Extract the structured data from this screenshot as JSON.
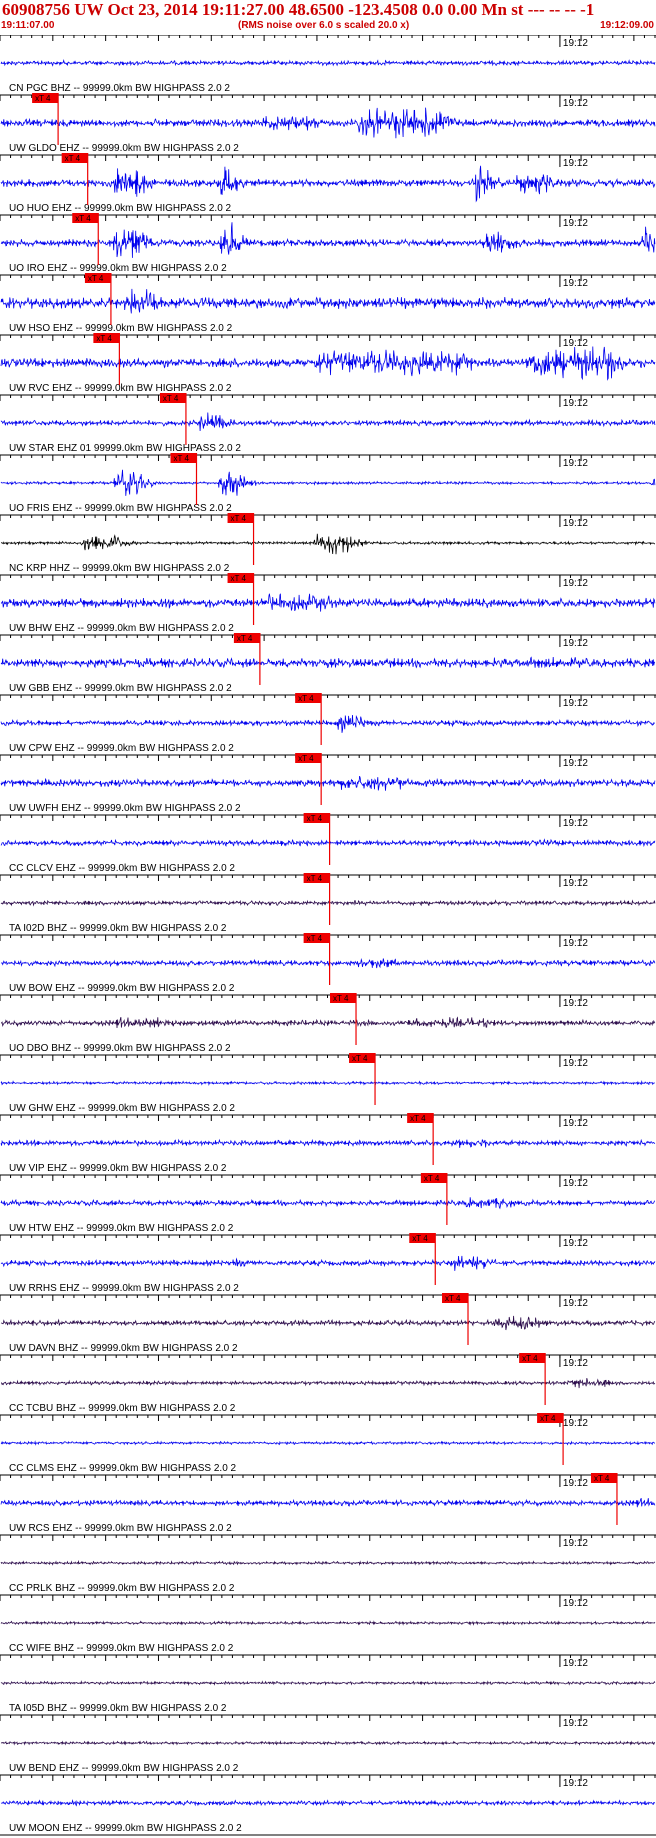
{
  "header": {
    "title": "60908756 UW Oct 23, 2014 19:11:27.00   48.6500 -123.4508  0.0 0.00 Mn st --- -- --  -1",
    "start_time": "19:11:07.00",
    "note": "(RMS noise over 6.0 s scaled 20.0 x)",
    "end_time": "19:12:09.00"
  },
  "chart_data": {
    "type": "line",
    "title": "60908756 UW Oct 23, 2014 19:11:27.00   48.6500 -123.4508  0.0 0.00 Mn st --- -- --  -1",
    "x_axis": {
      "start": "19:11:07.00",
      "end": "19:12:09.00",
      "minute_tick": "19:12",
      "minute_tick_seconds_from_start": 53
    },
    "pick_label": "xT 4",
    "colors": {
      "blue": "#0000ee",
      "dark": "#2a0a4a",
      "black": "#000000",
      "pick": "#ee0000"
    },
    "series": [
      {
        "name": "CN PGC BHZ -- 99999.0km BW  HIGHPASS  2.0  2",
        "color": "blue",
        "amp": 2.5,
        "pick": null,
        "events": []
      },
      {
        "name": "UW GLDO EHZ -- 99999.0km BW  HIGHPASS  2.0  2",
        "color": "blue",
        "amp": 4,
        "pick": 5.5,
        "events": [
          [
            34,
            8,
            16
          ],
          [
            25,
            5,
            8
          ]
        ]
      },
      {
        "name": "UO HUO EHZ -- 99999.0km BW  HIGHPASS  2.0  2",
        "color": "blue",
        "amp": 4,
        "pick": 8.3,
        "events": [
          [
            11,
            2,
            22
          ],
          [
            21,
            0.8,
            24
          ],
          [
            45,
            0.8,
            22
          ],
          [
            49,
            3,
            12
          ]
        ]
      },
      {
        "name": "UO IRO EHZ -- 99999.0km BW  HIGHPASS  2.0  2",
        "color": "blue",
        "amp": 4,
        "pick": 9.3,
        "events": [
          [
            11,
            2,
            22
          ],
          [
            21,
            0.8,
            24
          ],
          [
            46,
            2,
            14
          ],
          [
            61,
            0.6,
            18
          ]
        ]
      },
      {
        "name": "UW HSO EHZ -- 99999.0km BW  HIGHPASS  2.0  2",
        "color": "blue",
        "amp": 6,
        "pick": 10.5,
        "events": [
          [
            12,
            2,
            16
          ],
          [
            64,
            2,
            8
          ]
        ]
      },
      {
        "name": "UW RVC EHZ -- 99999.0km BW  HIGHPASS  2.0  2",
        "color": "blue",
        "amp": 5,
        "pick": 11.3,
        "events": [
          [
            30,
            14,
            14
          ],
          [
            50,
            8,
            18
          ]
        ]
      },
      {
        "name": "UW STAR EHZ 01 99999.0km BW  HIGHPASS  2.0  2",
        "color": "blue",
        "amp": 3,
        "pick": 17.6,
        "events": [
          [
            19,
            2,
            12
          ]
        ]
      },
      {
        "name": "UO FRIS EHZ -- 99999.0km BW  HIGHPASS  2.0  2",
        "color": "blue",
        "amp": 1.5,
        "pick": 18.6,
        "events": [
          [
            11,
            2,
            14
          ],
          [
            21,
            1,
            20
          ],
          [
            62,
            0.8,
            14
          ]
        ]
      },
      {
        "name": "NC KRP HHZ -- 99999.0km BW  HIGHPASS  2.0  2",
        "color": "black",
        "amp": 1.5,
        "pick": 24,
        "events": [
          [
            8,
            3,
            10
          ],
          [
            30,
            3,
            12
          ]
        ]
      },
      {
        "name": "UW BHW EHZ -- 99999.0km BW  HIGHPASS  2.0  2",
        "color": "blue",
        "amp": 5,
        "pick": 24,
        "events": [
          [
            25,
            6,
            10
          ]
        ]
      },
      {
        "name": "UW GBB EHZ -- 99999.0km BW  HIGHPASS  2.0  2",
        "color": "blue",
        "amp": 5,
        "pick": 24.6,
        "events": [
          [
            45,
            10,
            6
          ]
        ]
      },
      {
        "name": "UW CPW EHZ -- 99999.0km BW  HIGHPASS  2.0  2",
        "color": "blue",
        "amp": 3,
        "pick": 30.4,
        "events": [
          [
            32,
            2,
            10
          ]
        ]
      },
      {
        "name": "UW UWFH EHZ -- 99999.0km BW  HIGHPASS  2.0  2",
        "color": "blue",
        "amp": 4,
        "pick": 30.4,
        "events": [
          [
            32,
            6,
            8
          ]
        ]
      },
      {
        "name": "CC CLCV EHZ -- 99999.0km BW  HIGHPASS  2.0  2",
        "color": "blue",
        "amp": 3,
        "pick": 31.2,
        "events": [
          [
            51,
            1,
            4
          ]
        ]
      },
      {
        "name": "TA I02D BHZ -- 99999.0km BW  HIGHPASS  2.0  2",
        "color": "dark",
        "amp": 2.5,
        "pick": 31.2,
        "events": []
      },
      {
        "name": "UW BOW EHZ -- 99999.0km BW  HIGHPASS  2.0  2",
        "color": "blue",
        "amp": 3,
        "pick": 31.2,
        "events": [
          [
            34,
            3,
            6
          ]
        ]
      },
      {
        "name": "UO DBO BHZ -- 99999.0km BW  HIGHPASS  2.0  2",
        "color": "dark",
        "amp": 3,
        "pick": 33.7,
        "events": [
          [
            11,
            5,
            6
          ],
          [
            38,
            5,
            5
          ],
          [
            42,
            4,
            6
          ]
        ]
      },
      {
        "name": "UW GHW EHZ -- 99999.0km BW  HIGHPASS  2.0  2",
        "color": "blue",
        "amp": 1.5,
        "pick": 35.5,
        "events": []
      },
      {
        "name": "UW VIP EHZ -- 99999.0km BW  HIGHPASS  2.0  2",
        "color": "blue",
        "amp": 3,
        "pick": 41,
        "events": [
          [
            43,
            3,
            5
          ]
        ]
      },
      {
        "name": "UW HTW EHZ -- 99999.0km BW  HIGHPASS  2.0  2",
        "color": "blue",
        "amp": 3,
        "pick": 42.3,
        "events": [
          [
            44,
            4,
            6
          ]
        ]
      },
      {
        "name": "UW RRHS EHZ -- 99999.0km BW  HIGHPASS  2.0  2",
        "color": "blue",
        "amp": 3,
        "pick": 41.2,
        "events": [
          [
            43,
            3,
            8
          ],
          [
            22,
            0.6,
            6
          ]
        ]
      },
      {
        "name": "UW DAVN BHZ -- 99999.0km BW  HIGHPASS  2.0  2",
        "color": "dark",
        "amp": 3,
        "pick": 44.3,
        "events": [
          [
            47,
            4,
            8
          ]
        ]
      },
      {
        "name": "CC TCBU BHZ -- 99999.0km BW  HIGHPASS  2.0  2",
        "color": "dark",
        "amp": 2,
        "pick": 51.6,
        "events": [
          [
            54,
            3,
            6
          ]
        ]
      },
      {
        "name": "CC CLMS EHZ -- 99999.0km BW  HIGHPASS  2.0  2",
        "color": "blue",
        "amp": 1.5,
        "pick": 53.3,
        "events": []
      },
      {
        "name": "UW RCS EHZ -- 99999.0km BW  HIGHPASS  2.0  2",
        "color": "blue",
        "amp": 3,
        "pick": 58.4,
        "events": [
          [
            20,
            4,
            3
          ],
          [
            60,
            3,
            5
          ]
        ]
      },
      {
        "name": "CC PRLK BHZ -- 99999.0km BW  HIGHPASS  2.0  2",
        "color": "dark",
        "amp": 1.5,
        "pick": null,
        "events": []
      },
      {
        "name": "CC WIFE BHZ -- 99999.0km BW  HIGHPASS  2.0  2",
        "color": "dark",
        "amp": 1.5,
        "pick": null,
        "events": []
      },
      {
        "name": "TA I05D BHZ -- 99999.0km BW  HIGHPASS  2.0  2",
        "color": "dark",
        "amp": 1.5,
        "pick": null,
        "events": []
      },
      {
        "name": "UW BEND EHZ -- 99999.0km BW  HIGHPASS  2.0  2",
        "color": "dark",
        "amp": 1.5,
        "pick": null,
        "events": []
      },
      {
        "name": "UW MOON EHZ -- 99999.0km BW  HIGHPASS  2.0  2",
        "color": "blue",
        "amp": 2.5,
        "pick": null,
        "events": []
      }
    ]
  }
}
